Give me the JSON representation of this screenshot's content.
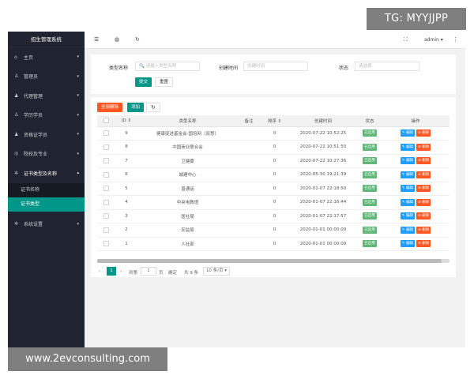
{
  "app": {
    "title": "招生管理系统"
  },
  "sidebar": {
    "items": [
      {
        "label": "主页",
        "icon": "home-icon",
        "glyph": "⌂"
      },
      {
        "label": "管理员",
        "icon": "user-icon",
        "glyph": "♙"
      },
      {
        "label": "代理管理",
        "icon": "person-icon",
        "glyph": "♟"
      },
      {
        "label": "学历学员",
        "icon": "student-icon",
        "glyph": "♙"
      },
      {
        "label": "资格证学员",
        "icon": "group-icon",
        "glyph": "♟"
      },
      {
        "label": "院校及专业",
        "icon": "school-icon",
        "glyph": "◎"
      },
      {
        "label": "证书类型及名称",
        "icon": "settings-icon",
        "glyph": "✲"
      }
    ],
    "sub_items": [
      {
        "label": "证书名称"
      },
      {
        "label": "证书类型"
      }
    ],
    "last_item": {
      "label": "系统设置",
      "icon": "gear-icon",
      "glyph": "✲"
    }
  },
  "topbar": {
    "menu_glyph": "☰",
    "globe_glyph": "◍",
    "refresh_glyph": "↻",
    "fullscreen_glyph": "⛶",
    "user": "admin",
    "more_glyph": "⋮"
  },
  "filters": {
    "type_name_label": "类型名称",
    "type_name_placeholder": "🔍 请输入类型名称",
    "created_time_label": "创建时间",
    "created_time_placeholder": "创建时间",
    "status_label": "状态",
    "status_placeholder": "请选择",
    "submit_label": "提交",
    "reset_label": "重置"
  },
  "toolbar": {
    "delete_all_label": "全部删除",
    "add_label": "添加",
    "refresh_glyph": "↻"
  },
  "table": {
    "headers": [
      "",
      "ID ⇕",
      "类型名称",
      "备注",
      "排序 ⇕",
      "创建时间",
      "状态",
      "操作"
    ],
    "rows": [
      {
        "id": "9",
        "name": "健康促进基金会-国培网（双慧）",
        "note": "",
        "sort": "0",
        "created": "2020-07-22 10:52:25"
      },
      {
        "id": "8",
        "name": "中国商业联合会",
        "note": "",
        "sort": "0",
        "created": "2020-07-22 10:51:50"
      },
      {
        "id": "7",
        "name": "卫健委",
        "note": "",
        "sort": "0",
        "created": "2020-07-22 10:27:36"
      },
      {
        "id": "6",
        "name": "城建中心",
        "note": "",
        "sort": "0",
        "created": "2020-05-30 19:21:39"
      },
      {
        "id": "5",
        "name": "普通话",
        "note": "",
        "sort": "0",
        "created": "2020-01-07 22:18:50"
      },
      {
        "id": "4",
        "name": "中央电教馆",
        "note": "",
        "sort": "0",
        "created": "2020-01-07 22:16:44"
      },
      {
        "id": "3",
        "name": "医社局",
        "note": "",
        "sort": "0",
        "created": "2020-01-07 22:17:57"
      },
      {
        "id": "2",
        "name": "安监局",
        "note": "",
        "sort": "0",
        "created": "2020-01-01 00:00:00"
      },
      {
        "id": "1",
        "name": "人社部",
        "note": "",
        "sort": "0",
        "created": "2020-01-01 00:00:00"
      }
    ],
    "status_label": "已启用",
    "edit_label": "✎ 编辑",
    "delete_label": "⊘ 删除"
  },
  "pager": {
    "prev_glyph": "‹",
    "current_page": "1",
    "next_glyph": "›",
    "goto_label": "到第",
    "goto_value": "1",
    "page_unit": "页",
    "confirm_label": "确定",
    "total_label": "共 9 条",
    "page_size": "10 条/页 ▾"
  },
  "watermarks": {
    "tg": "TG: MYYJJPP",
    "url": "www.2evconsulting.com"
  },
  "colors": {
    "sidebar_bg": "#1f2430",
    "accent": "#009688",
    "danger": "#ff5722",
    "info": "#1e9fff",
    "success": "#5fb878"
  }
}
